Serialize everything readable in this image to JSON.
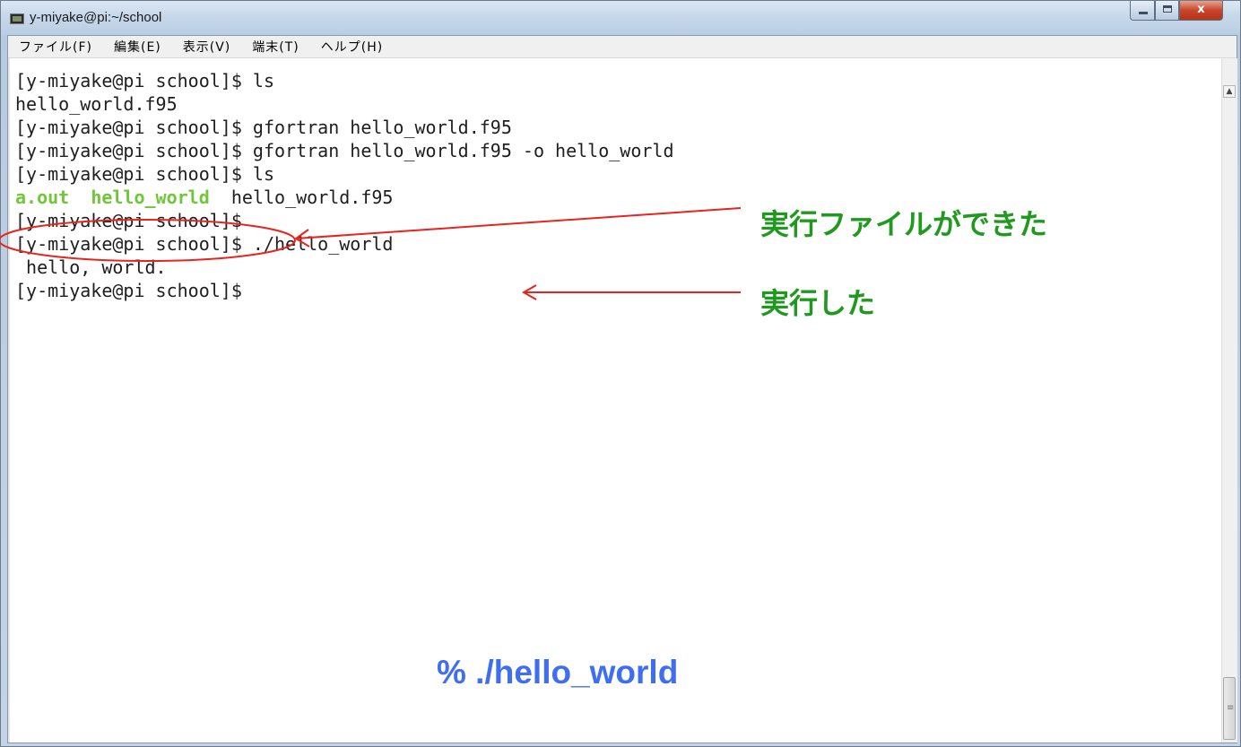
{
  "window": {
    "title": "y-miyake@pi:~/school",
    "buttons": {
      "minimize": "",
      "maximize": "",
      "close": "x"
    }
  },
  "menu": [
    {
      "label": "ファイル(F)"
    },
    {
      "label": "編集(E)"
    },
    {
      "label": "表示(V)"
    },
    {
      "label": "端末(T)"
    },
    {
      "label": "ヘルプ(H)"
    }
  ],
  "terminal": {
    "lines": [
      "[y-miyake@pi school]$ ls",
      "hello_world.f95",
      "[y-miyake@pi school]$ gfortran hello_world.f95",
      "[y-miyake@pi school]$ gfortran hello_world.f95 -o hello_world",
      "[y-miyake@pi school]$ ls",
      "",
      "[y-miyake@pi school]$",
      "[y-miyake@pi school]$ ./hello_world",
      " hello, world.",
      "[y-miyake@pi school]$"
    ],
    "ls_output": {
      "exec1": "a.out",
      "exec2": "hello_world",
      "source": "hello_world.f95"
    }
  },
  "annotations": {
    "executable_created": "実行ファイルができた",
    "executed": "実行した",
    "command": "% ./hello_world"
  },
  "colors": {
    "terminal_text": "#1e1e1e",
    "executable_green": "#71c63a",
    "annotation_green": "#1f9a1f",
    "annotation_red": "#e5251f",
    "caption_blue": "#3f6ff0"
  }
}
